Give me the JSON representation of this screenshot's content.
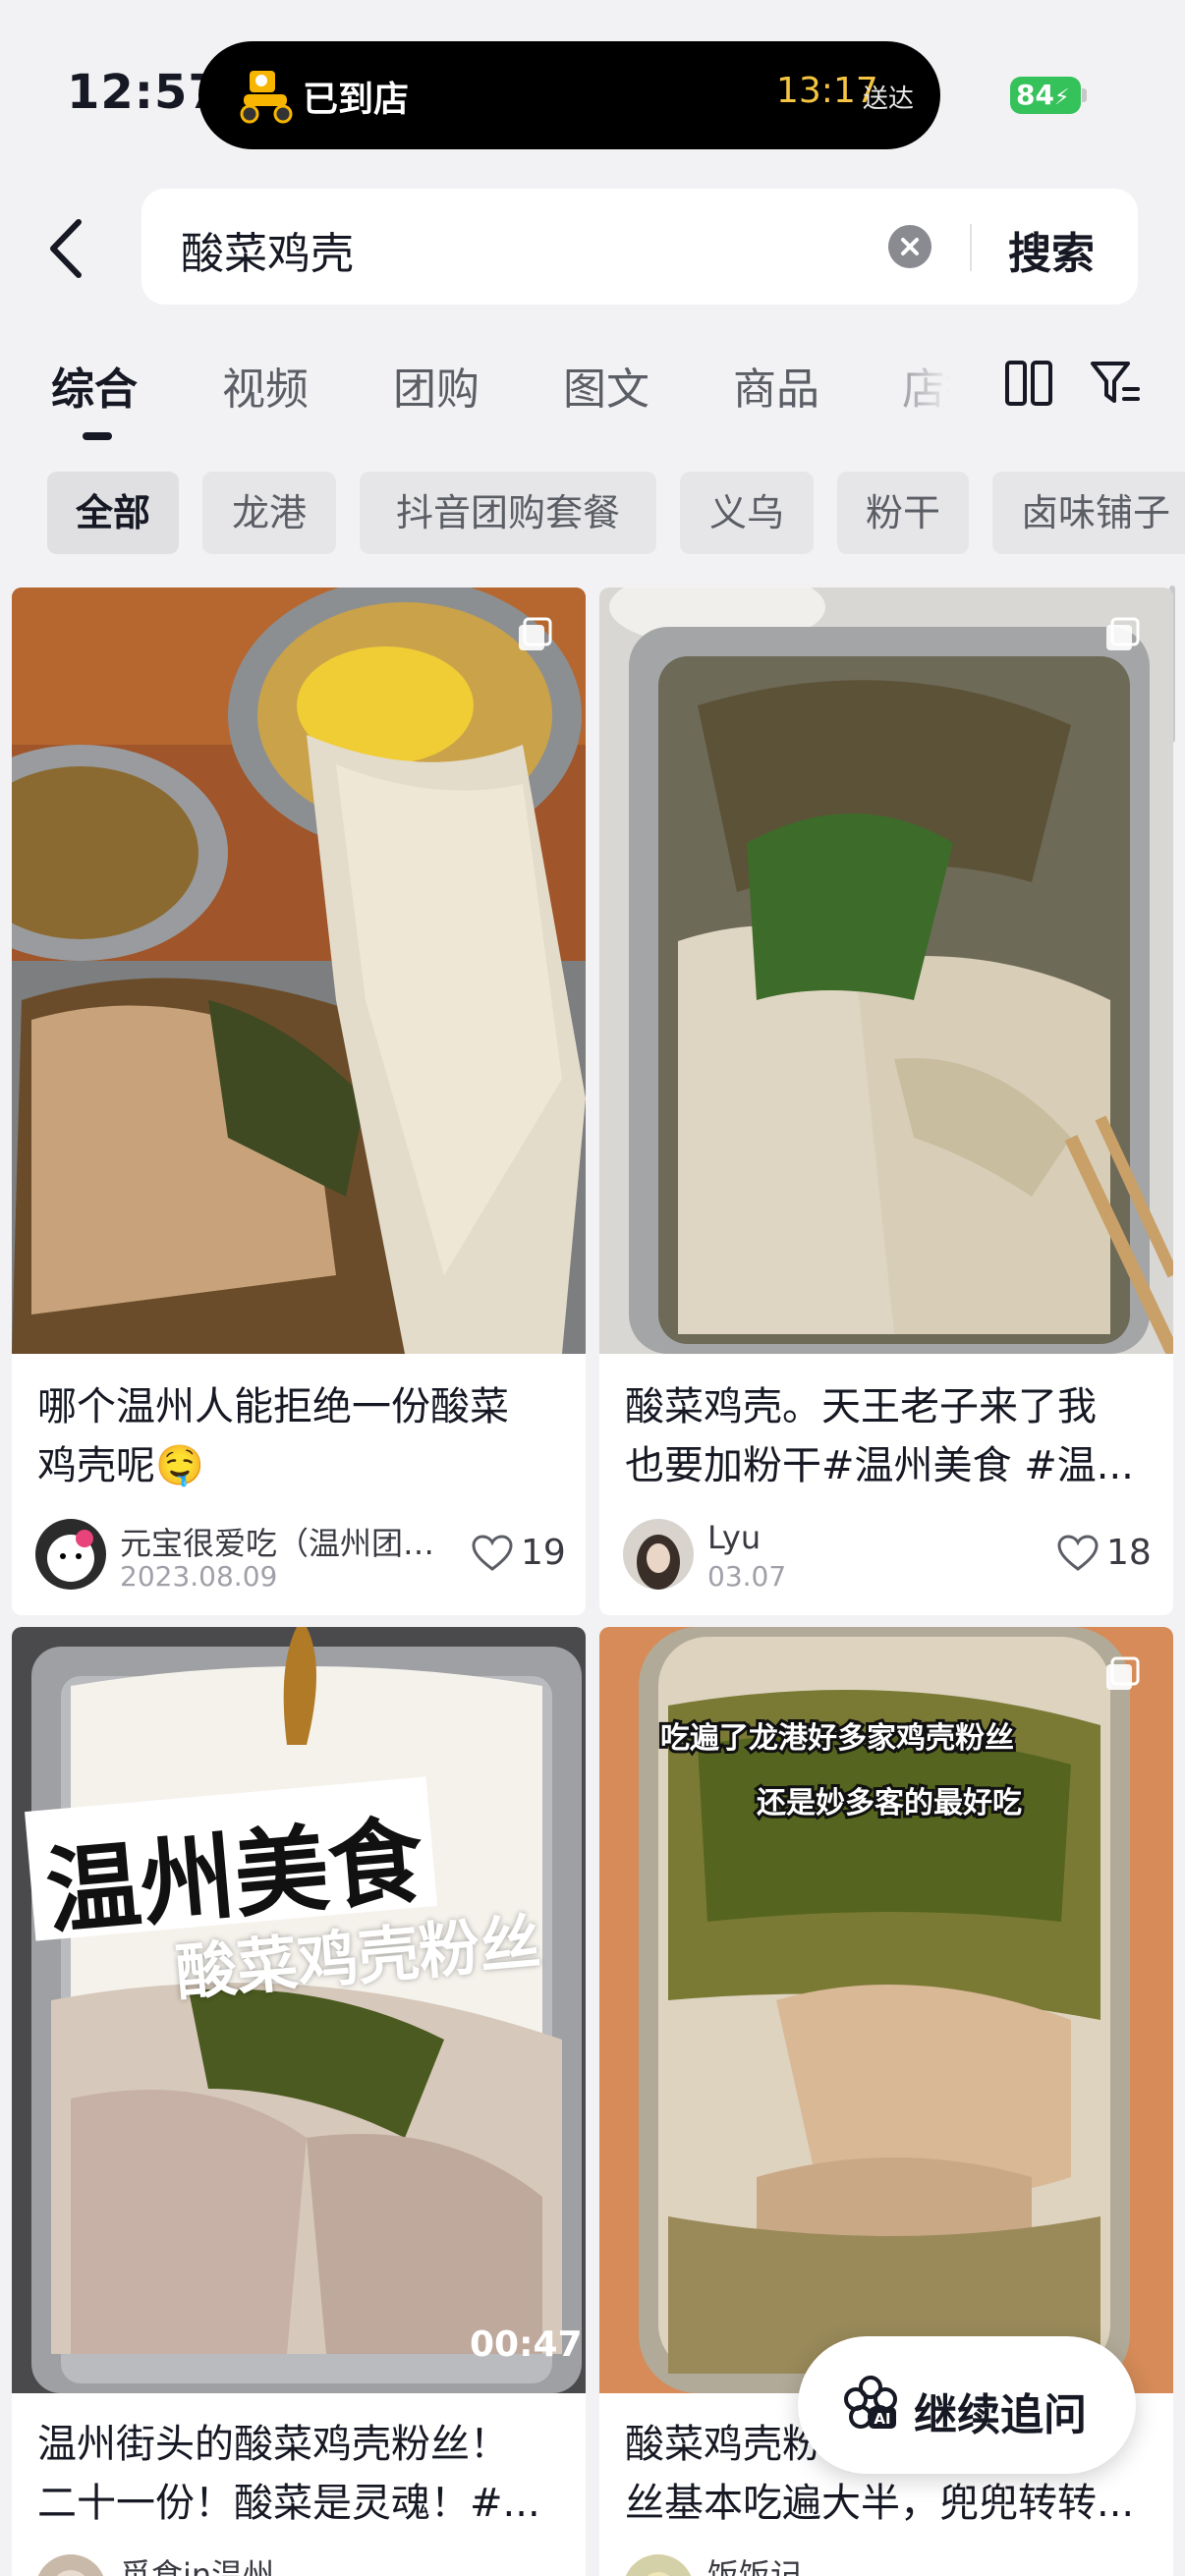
{
  "status_bar": {
    "time": "12:57",
    "island_status": "已到店",
    "eta_time": "13:17",
    "eta_label": "送达",
    "battery": "84"
  },
  "search": {
    "query": "酸菜鸡壳",
    "button": "搜索"
  },
  "tabs": [
    "综合",
    "视频",
    "团购",
    "图文",
    "商品",
    "店铺"
  ],
  "chips": [
    "全部",
    "龙港",
    "抖音团购套餐",
    "义乌",
    "粉干",
    "卤味铺子"
  ],
  "cards": [
    {
      "title_line1": "哪个温州人能拒绝一份酸菜",
      "title_line2": "鸡壳呢🤤",
      "author": "元宝很爱吃（温州团…",
      "date": "2023.08.09",
      "likes": "19"
    },
    {
      "title_line1": "酸菜鸡壳。天王老子来了我",
      "title_line2": "也要加粉干#温州美食 #温...",
      "author": "Lyu",
      "date": "03.07",
      "likes": "18"
    },
    {
      "title_line1": "温州街头的酸菜鸡壳粉丝！",
      "title_line2": "二十一份！酸菜是灵魂！#...",
      "author": "觅食in温州",
      "duration": "00:47",
      "overlay_line1": "温州美食",
      "overlay_line2": "酸菜鸡壳粉丝"
    },
    {
      "title_line1": "酸菜鸡壳粉",
      "title_line2": "丝基本吃遍大半，兜兜转转...",
      "author": "饭饭记",
      "overlay_line1": "吃遍了龙港好多家鸡壳粉丝",
      "overlay_line2": "还是妙多客的最好吃"
    }
  ],
  "float_button": {
    "label": "继续追问",
    "icon": "ai-flower-icon"
  },
  "colors": {
    "background": "#f2f2f4",
    "eta_yellow": "#f5c542",
    "battery_green": "#36c25b"
  }
}
